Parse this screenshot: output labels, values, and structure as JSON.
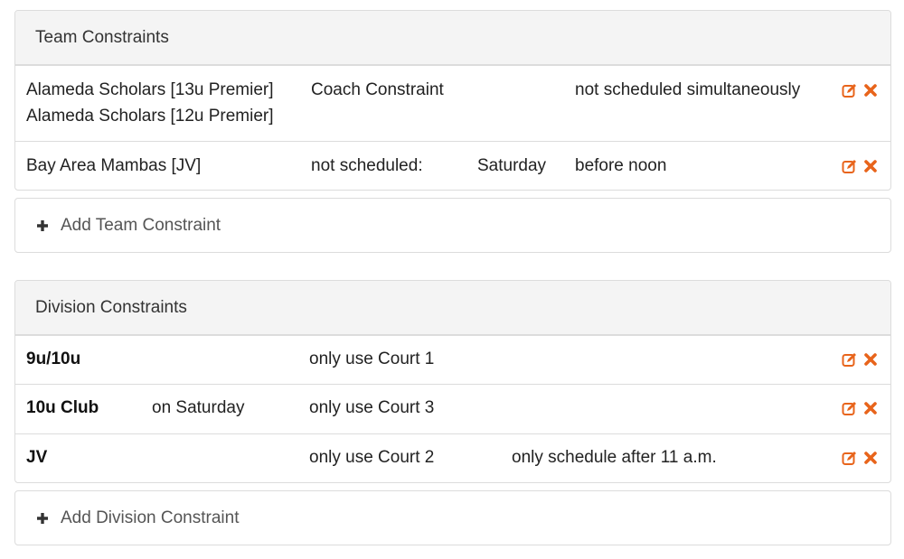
{
  "accent_color": "#e8641b",
  "team_constraints": {
    "title": "Team Constraints",
    "rows": [
      {
        "teams": [
          "Alameda Scholars [13u Premier]",
          "Alameda Scholars [12u Premier]"
        ],
        "type": "Coach Constraint",
        "day": "",
        "rule": "not scheduled simultaneously"
      },
      {
        "teams": [
          "Bay Area Mambas [JV]"
        ],
        "type": "not scheduled:",
        "day": "Saturday",
        "rule": "before noon"
      }
    ],
    "add_label": "Add Team Constraint"
  },
  "division_constraints": {
    "title": "Division Constraints",
    "rows": [
      {
        "division": "9u/10u",
        "when": "",
        "court": "only use Court 1",
        "time": ""
      },
      {
        "division": "10u Club",
        "when": "on Saturday",
        "court": "only use Court 3",
        "time": ""
      },
      {
        "division": "JV",
        "when": "",
        "court": "only use Court 2",
        "time": "only schedule after 11 a.m."
      }
    ],
    "add_label": "Add Division Constraint"
  },
  "icons": {
    "edit": "edit-icon",
    "delete": "delete-icon",
    "add": "plus-icon"
  }
}
